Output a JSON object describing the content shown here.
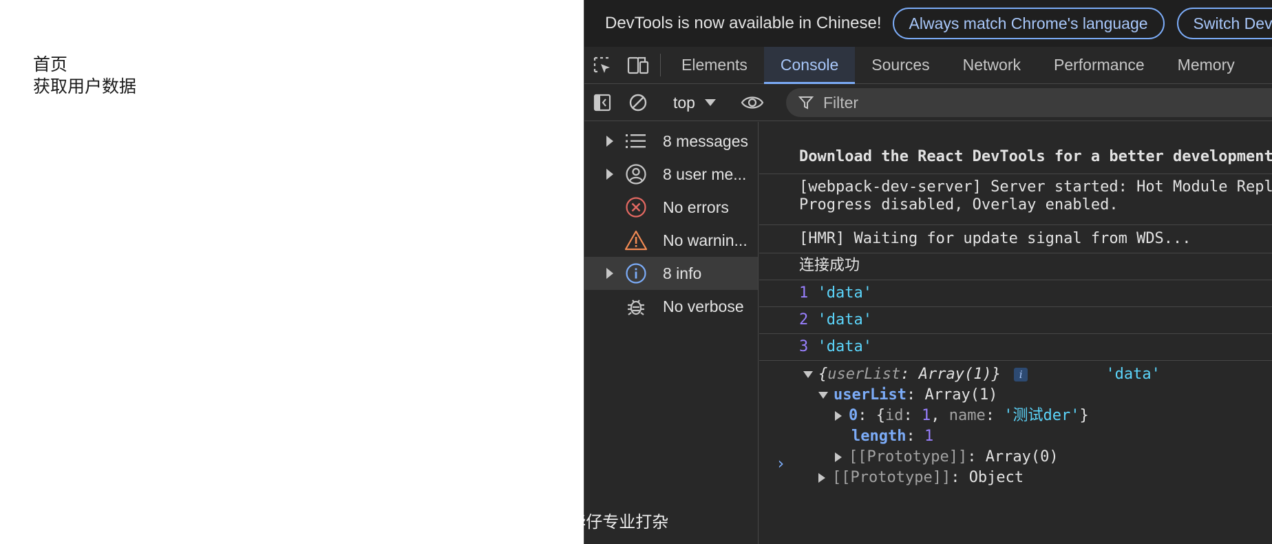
{
  "page": {
    "nav": [
      "首页",
      "获取用户数据"
    ]
  },
  "devtools": {
    "infobar": {
      "message": "DevTools is now available in Chinese!",
      "match_button": "Always match Chrome's language",
      "switch_button": "Switch DevTools to Chinese"
    },
    "tabs": [
      "Elements",
      "Console",
      "Sources",
      "Network",
      "Performance",
      "Memory"
    ],
    "active_tab": "Console",
    "toolbar": {
      "context": "top",
      "filter_placeholder": "Filter"
    },
    "sidebar": [
      {
        "label": "8 messages",
        "icon": "list-icon",
        "expandable": true
      },
      {
        "label": "8 user me...",
        "icon": "user-icon",
        "expandable": true
      },
      {
        "label": "No errors",
        "icon": "error-icon",
        "expandable": false
      },
      {
        "label": "No warnin...",
        "icon": "warning-icon",
        "expandable": false
      },
      {
        "label": "8 info",
        "icon": "info-icon",
        "expandable": true,
        "selected": true
      },
      {
        "label": "No verbose",
        "icon": "bug-icon",
        "expandable": false
      }
    ],
    "console": {
      "react_msg": "Download the React DevTools for a better development experience",
      "wds_line1": "[webpack-dev-server] Server started: Hot Module Replacement enabled, Live Reloading enabled,",
      "wds_line2": "Progress disabled, Overlay enabled.",
      "hmr_msg": "[HMR] Waiting for update signal from WDS...",
      "connected_msg": "连接成功",
      "data_logs": [
        {
          "num": "1",
          "str": "'data'"
        },
        {
          "num": "2",
          "str": "'data'"
        },
        {
          "num": "3",
          "str": "'data'"
        }
      ],
      "object": {
        "open_brace": "{",
        "key": "userList",
        "colon": ": ",
        "preview": "Array(1)",
        "close_brace": "}",
        "badge": "i",
        "trailing_str": "'data'",
        "userlist_key": "userList",
        "userlist_value": "Array(1)",
        "item_index": "0",
        "item_open": "{",
        "item_id_key": "id",
        "item_id_value": "1",
        "item_comma": ", ",
        "item_name_key": "name",
        "item_name_value": "'测试der'",
        "item_close": "}",
        "length_key": "length",
        "length_value": "1",
        "array_proto": "[[Prototype]]",
        "array_proto_value": "Array(0)",
        "obj_proto": "[[Prototype]]",
        "obj_proto_value": "Object"
      },
      "prompt": "›"
    }
  },
  "watermark": "掘金技术社区 @ 华仔专业打杂",
  "colors": {
    "accent": "#7cacf8",
    "string": "#5cd5fb",
    "number": "#9980ff",
    "error": "#e46962",
    "warning": "#f28b54"
  }
}
